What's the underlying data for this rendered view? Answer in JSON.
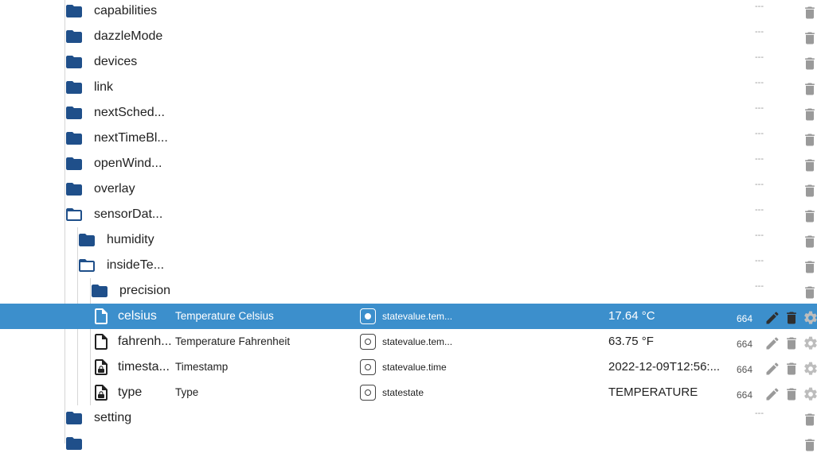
{
  "colors": {
    "folder": "#1f4f8a",
    "selected_row": "#3c8fcc",
    "action_icon": "#9a9a9a",
    "selected_action_icon": "#2f2f2f"
  },
  "icons": {
    "folder_closed": "folder-icon",
    "folder_open": "folder-open-icon",
    "state_file": "file-icon",
    "state_readonly": "file-lock-icon",
    "role": "role-state-icon",
    "edit": "pencil-icon",
    "delete": "trash-icon",
    "settings": "gear-icon"
  },
  "tree": {
    "folders": [
      {
        "name": "capabilities",
        "open": false,
        "placeholder": "---"
      },
      {
        "name": "dazzleMode",
        "open": false,
        "placeholder": "---"
      },
      {
        "name": "devices",
        "open": false,
        "placeholder": "---"
      },
      {
        "name": "link",
        "open": false,
        "placeholder": "---"
      },
      {
        "name": "nextSched...",
        "open": false,
        "placeholder": "---"
      },
      {
        "name": "nextTimeBl...",
        "open": false,
        "placeholder": "---"
      },
      {
        "name": "openWind...",
        "open": false,
        "placeholder": "---"
      },
      {
        "name": "overlay",
        "open": false,
        "placeholder": "---"
      },
      {
        "name": "sensorDat...",
        "open": true,
        "placeholder": "---"
      },
      {
        "name": "humidity",
        "open": false,
        "placeholder": "---"
      },
      {
        "name": "insideTe...",
        "open": true,
        "placeholder": "---"
      },
      {
        "name": "precision",
        "open": false,
        "placeholder": "---"
      }
    ],
    "states": [
      {
        "name": "celsius",
        "display_name": "Temperature Celsius",
        "role": "statevalue.tem...",
        "value": "17.64 °C",
        "acl": "664",
        "readonly": false,
        "selected": true
      },
      {
        "name": "fahrenh...",
        "display_name": "Temperature Fahrenheit",
        "role": "statevalue.tem...",
        "value": "63.75 °F",
        "acl": "664",
        "readonly": false,
        "selected": false
      },
      {
        "name": "timesta...",
        "display_name": "Timestamp",
        "role": "statevalue.time",
        "value": "2022-12-09T12:56:...",
        "acl": "664",
        "readonly": true,
        "selected": false
      },
      {
        "name": "type",
        "display_name": "Type",
        "role": "statestate",
        "value": "TEMPERATURE",
        "acl": "664",
        "readonly": true,
        "selected": false
      }
    ],
    "bottom_folders": [
      {
        "name": "setting",
        "open": false,
        "placeholder": "---"
      }
    ]
  }
}
